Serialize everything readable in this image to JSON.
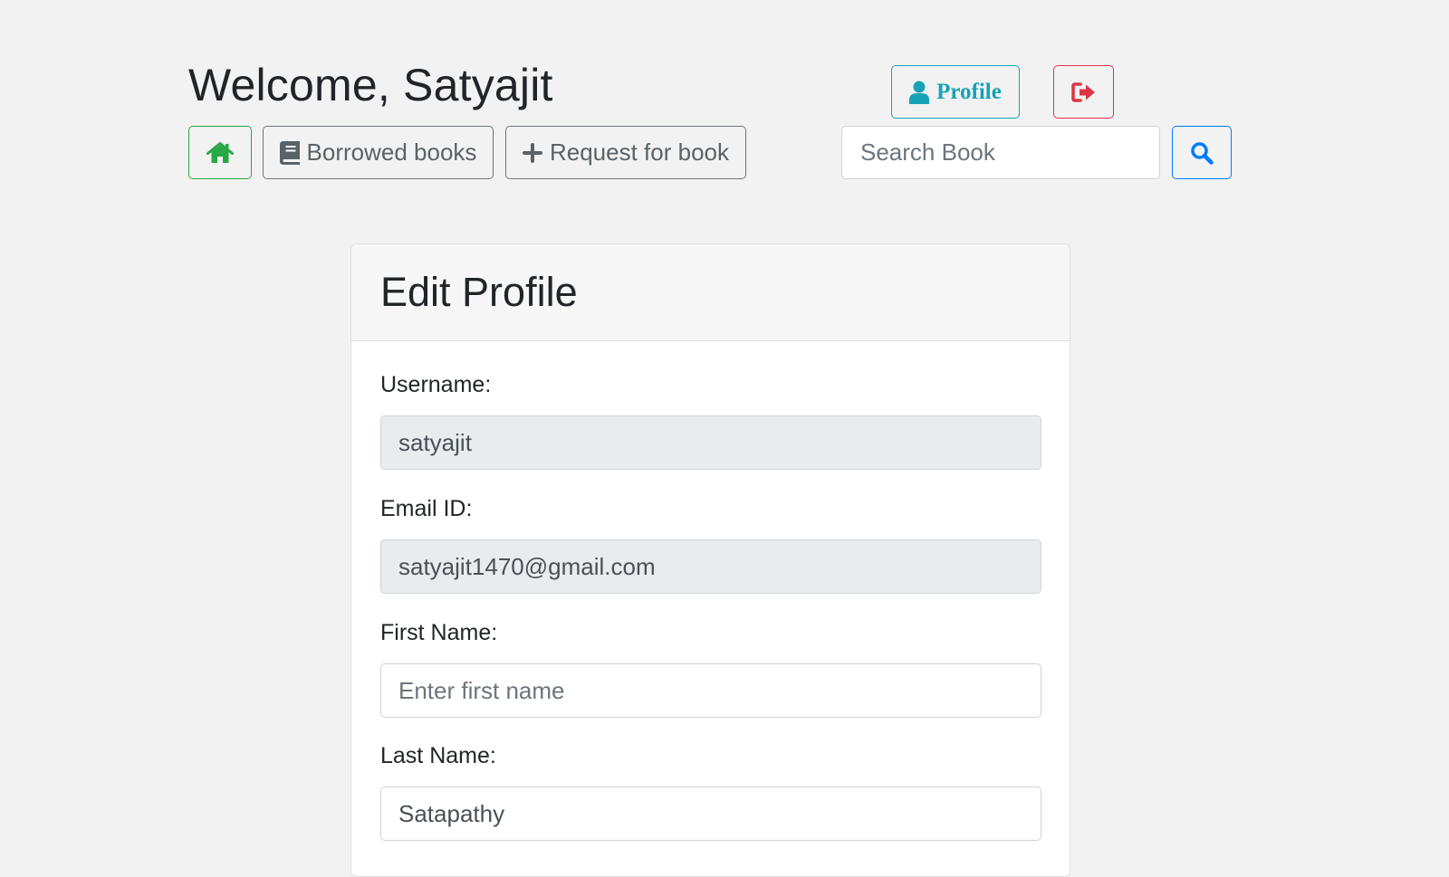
{
  "header": {
    "welcome_text": "Welcome, Satyajit",
    "profile_label": "Profile"
  },
  "nav": {
    "borrowed_label": "Borrowed books",
    "request_label": "Request for book"
  },
  "search": {
    "placeholder": "Search Book"
  },
  "profile_form": {
    "title": "Edit Profile",
    "username_label": "Username:",
    "username_value": "satyajit",
    "email_label": "Email ID:",
    "email_value": "satyajit1470@gmail.com",
    "first_name_label": "First Name:",
    "first_name_placeholder": "Enter first name",
    "first_name_value": "",
    "last_name_label": "Last Name:",
    "last_name_value": "Satapathy"
  },
  "colors": {
    "page_background": "#f2f2f2",
    "profile_accent": "#17a2b8",
    "logout_accent": "#dc3545",
    "home_accent": "#28a745",
    "secondary": "#6c757d",
    "search_accent": "#007bff",
    "readonly_field": "#e9ecef"
  },
  "icons": {
    "profile": "user-icon",
    "logout": "sign-out-icon",
    "home": "home-icon",
    "borrowed": "book-icon",
    "request": "plus-icon",
    "search": "search-icon"
  }
}
